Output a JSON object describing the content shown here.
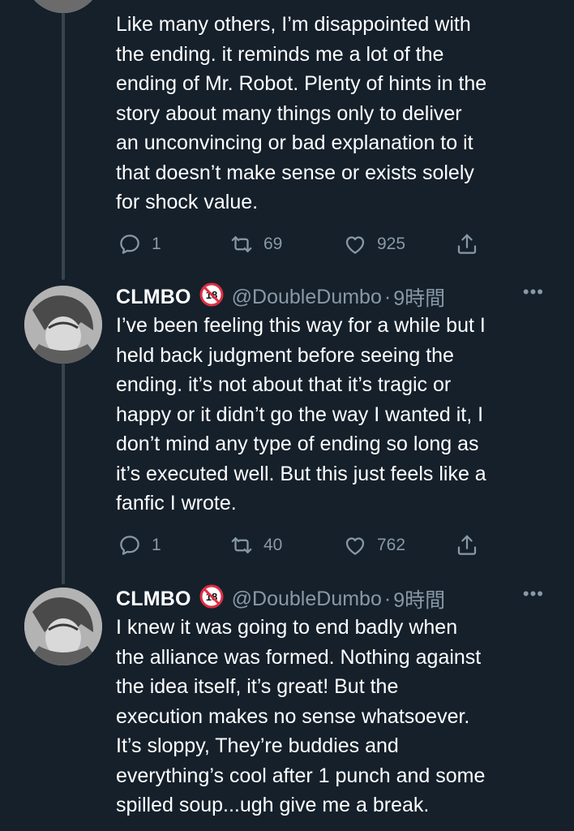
{
  "tweets": [
    {
      "body": "Like many others, I’m disappointed with\nthe ending. it reminds me a lot of the\nending of Mr. Robot. Plenty of hints in the\nstory about many things only to deliver\nan unconvincing or bad explanation to it\nthat doesn’t make sense or exists solely\nfor shock value.",
      "replies": "1",
      "retweets": "69",
      "likes": "925"
    },
    {
      "name": "CLMBO",
      "handle": "@DoubleDumbo",
      "dot": "·",
      "time": "9時間",
      "more": "•••",
      "body": "I’ve been feeling this way for a while but I\nheld back judgment before seeing the\nending. it’s not about that it’s tragic or\nhappy or it didn’t go the way I wanted it, I\ndon’t mind any type of ending so long as\nit’s executed well. But this just feels like a\nfanfic I wrote.",
      "replies": "1",
      "retweets": "40",
      "likes": "762"
    },
    {
      "name": "CLMBO",
      "handle": "@DoubleDumbo",
      "dot": "·",
      "time": "9時間",
      "more": "•••",
      "body": "I knew it was going to end badly when\nthe alliance was formed. Nothing against\nthe idea itself, it’s great! But the\nexecution makes no sense whatsoever.\nIt’s sloppy, They’re buddies and\neverything’s cool after 1 punch and some\nspilled soup...ugh give me a break."
    }
  ],
  "icons": {
    "reply": "reply-icon",
    "retweet": "retweet-icon",
    "like": "heart-icon",
    "share": "share-icon",
    "badge": "no-under-18-icon"
  },
  "colors": {
    "background": "#15202b",
    "text": "#ffffff",
    "secondary": "#8899a6",
    "thread_line": "#38444d",
    "badge_red": "#dd2e44"
  }
}
